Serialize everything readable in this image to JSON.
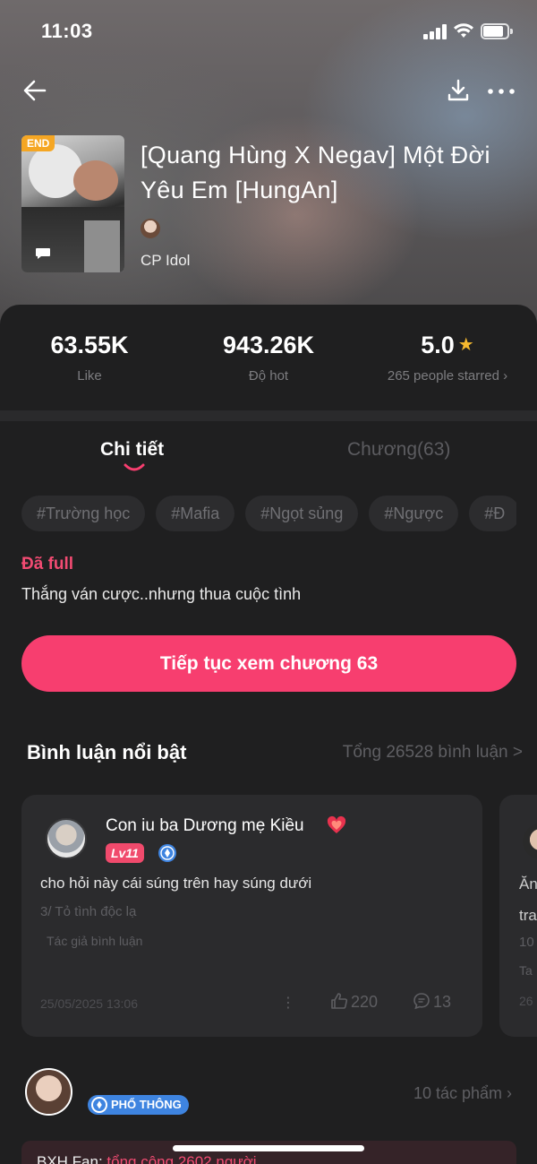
{
  "status_bar": {
    "time": "11:03"
  },
  "story": {
    "end_badge": "END",
    "title": "[Quang Hùng X Negav] Một Đời Yêu Em [HungAn]",
    "category": "CP Idol"
  },
  "stats": {
    "likes": {
      "value": "63.55K",
      "label": "Like"
    },
    "hot": {
      "value": "943.26K",
      "label": "Độ hot"
    },
    "rating": {
      "value": "5.0",
      "label": "265 people starred ›"
    }
  },
  "tabs": {
    "detail": "Chi tiết",
    "chapters": "Chương(63)"
  },
  "tags": [
    "#Trường học",
    "#Mafia",
    "#Ngọt sủng",
    "#Ngược",
    "#Đ"
  ],
  "status_text": "Đã full",
  "summary": "Thắng ván cược..nhưng thua cuộc tình",
  "cta_label": "Tiếp tục xem chương 63",
  "comments": {
    "heading": "Bình luận nổi bật",
    "total": "Tổng 26528 bình luận >",
    "featured": {
      "username": "Con iu ba Dương mẹ Kiều",
      "level": "Lv11",
      "text": "cho hỏi này cái súng trên hay súng dưới",
      "chapter": "3/ Tỏ tình độc lạ",
      "author_label": "Tác giả bình luận",
      "date": "25/05/2025 13:06",
      "likes": "220",
      "replies": "13"
    },
    "next_preview": {
      "line1": "Ăn",
      "line2": "tra",
      "line3": "10",
      "line4": "Ta",
      "line5": "26"
    }
  },
  "author_section": {
    "badge": "PHỔ THÔNG",
    "works": "10 tác phẩm  ›"
  },
  "bottom_banner": {
    "prefix": "BXH Fan: ",
    "highlight": "tổng cộng 2602 người"
  },
  "colors": {
    "accent": "#f73e6f",
    "status": "#f24b72",
    "badge_blue": "#3e84e0",
    "star": "#f5b82e"
  }
}
